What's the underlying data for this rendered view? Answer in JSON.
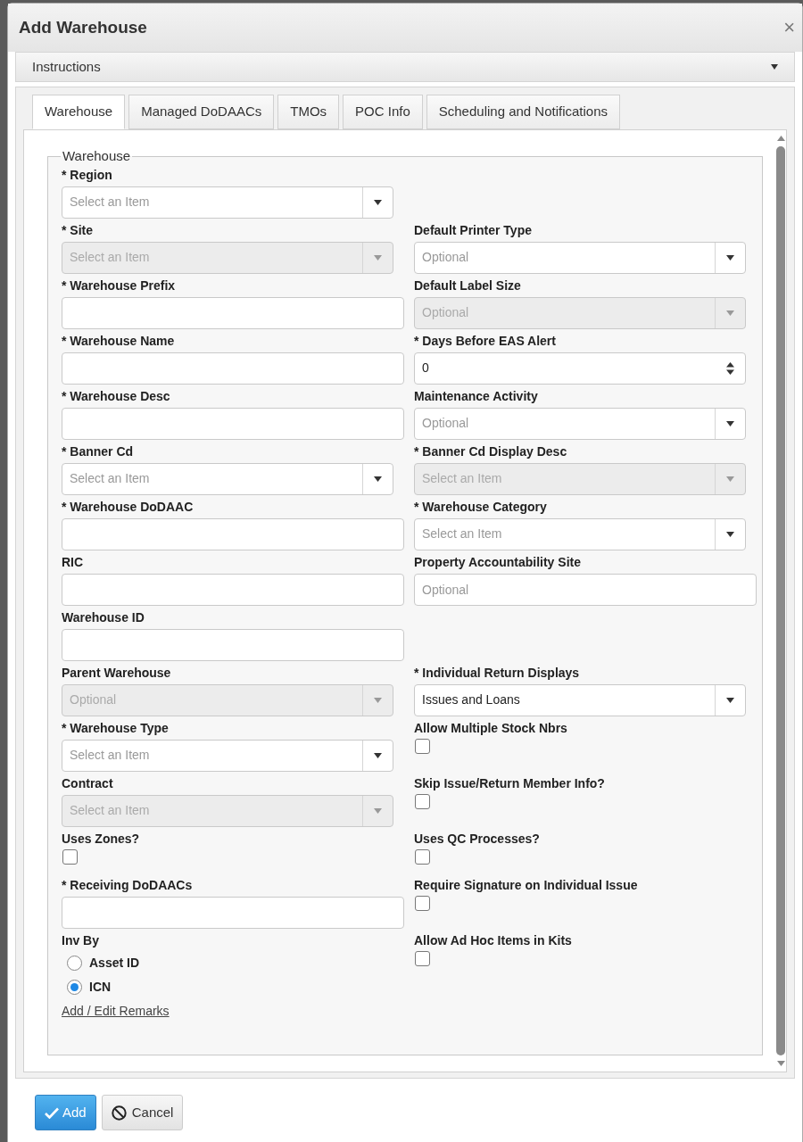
{
  "window": {
    "title": "Add Warehouse",
    "close": "×"
  },
  "instructions": {
    "label": "Instructions",
    "expanded": false
  },
  "tabs": [
    {
      "label": "Warehouse",
      "selected": true
    },
    {
      "label": "Managed DoDAACs",
      "selected": false
    },
    {
      "label": "TMOs",
      "selected": false
    },
    {
      "label": "POC Info",
      "selected": false
    },
    {
      "label": "Scheduling and Notifications",
      "selected": false
    }
  ],
  "form": {
    "legend": "Warehouse",
    "rows": [
      {
        "left": {
          "kind": "select",
          "label": "* Region",
          "placeholder": "Select an Item",
          "disabled": false
        },
        "right": null
      },
      {
        "left": {
          "kind": "select",
          "label": "* Site",
          "placeholder": "Select an Item",
          "disabled": true
        },
        "right": {
          "kind": "select",
          "label": "Default Printer Type",
          "placeholder": "Optional",
          "disabled": false
        }
      },
      {
        "left": {
          "kind": "text",
          "label": "* Warehouse Prefix"
        },
        "right": {
          "kind": "select",
          "label": "Default Label Size",
          "placeholder": "Optional",
          "disabled": true
        }
      },
      {
        "left": {
          "kind": "text",
          "label": "* Warehouse Name"
        },
        "right": {
          "kind": "spinner",
          "label": "* Days Before EAS Alert",
          "value": "0"
        }
      },
      {
        "left": {
          "kind": "text",
          "label": "* Warehouse Desc"
        },
        "right": {
          "kind": "select",
          "label": "Maintenance Activity",
          "placeholder": "Optional",
          "disabled": false
        }
      },
      {
        "left": {
          "kind": "select",
          "label": "* Banner Cd",
          "placeholder": "Select an Item",
          "disabled": false
        },
        "right": {
          "kind": "select",
          "label": "* Banner Cd Display Desc",
          "placeholder": "Select an Item",
          "disabled": true
        }
      },
      {
        "left": {
          "kind": "text",
          "label": "* Warehouse DoDAAC"
        },
        "right": {
          "kind": "select",
          "label": "* Warehouse Category",
          "placeholder": "Select an Item",
          "disabled": false
        }
      },
      {
        "left": {
          "kind": "text",
          "label": "RIC"
        },
        "right": {
          "kind": "text",
          "label": "Property Accountability Site",
          "placeholder": "Optional"
        }
      },
      {
        "left": {
          "kind": "text",
          "label": "Warehouse ID"
        },
        "right": null
      },
      {
        "left": {
          "kind": "select",
          "label": "Parent Warehouse",
          "placeholder": "Optional",
          "disabled": true
        },
        "right": {
          "kind": "select",
          "label": "* Individual Return Displays",
          "value": "Issues and Loans",
          "disabled": false
        }
      },
      {
        "left": {
          "kind": "select",
          "label": "* Warehouse Type",
          "placeholder": "Select an Item",
          "disabled": false
        },
        "right": {
          "kind": "checkbox",
          "label": "Allow Multiple Stock Nbrs",
          "checked": false
        }
      },
      {
        "left": {
          "kind": "select",
          "label": "Contract",
          "placeholder": "Select an Item",
          "disabled": true
        },
        "right": {
          "kind": "checkbox",
          "label": "Skip Issue/Return Member Info?",
          "checked": false
        }
      },
      {
        "left": {
          "kind": "checkbox",
          "label": "Uses Zones?",
          "checked": false
        },
        "right": {
          "kind": "checkbox",
          "label": "Uses QC Processes?",
          "checked": false
        }
      },
      {
        "left": {
          "kind": "text",
          "label": "* Receiving DoDAACs"
        },
        "right": {
          "kind": "checkbox",
          "label": "Require Signature on Individual Issue",
          "checked": false
        }
      },
      {
        "left": {
          "kind": "radio",
          "label": "Inv By",
          "options": [
            {
              "label": "Asset ID",
              "selected": false
            },
            {
              "label": "ICN",
              "selected": true
            }
          ]
        },
        "right": {
          "kind": "checkbox",
          "label": "Allow Ad Hoc Items in Kits",
          "checked": false
        }
      }
    ],
    "link": "Add / Edit Remarks"
  },
  "buttons": [
    {
      "kind": "primary",
      "label": "Add"
    },
    {
      "kind": "cancel",
      "label": "Cancel"
    }
  ]
}
